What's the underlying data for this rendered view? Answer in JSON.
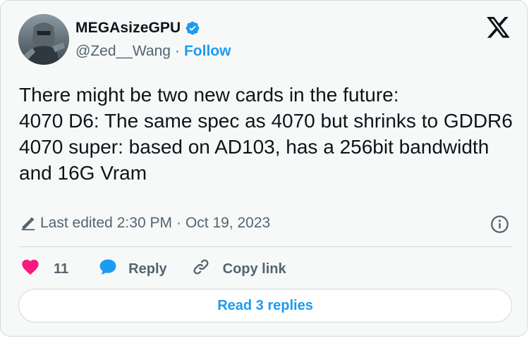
{
  "author": {
    "display_name": "MEGAsizeGPU",
    "handle": "@Zed__Wang",
    "separator": "·",
    "follow_label": "Follow"
  },
  "tweet": {
    "text": "There might be two new cards in the future:\n4070 D6: The same spec as 4070 but shrinks to GDDR6\n4070 super: based on AD103, has a 256bit bandwidth and 16G Vram",
    "edited_label": "Last edited",
    "time": "2:30 PM",
    "date_separator": "·",
    "date": "Oct 19, 2023"
  },
  "actions": {
    "like_count": "11",
    "reply_label": "Reply",
    "copy_label": "Copy link"
  },
  "read_replies_label": "Read 3 replies",
  "icons": {
    "verified": "verified-badge-icon",
    "logo": "x-logo-icon",
    "edit": "pencil-icon",
    "info": "info-icon",
    "like": "heart-icon",
    "reply": "speech-bubble-icon",
    "copy": "link-icon"
  },
  "colors": {
    "accent": "#1d9bf0",
    "like": "#f91880",
    "muted_text": "#536471",
    "text": "#0f1419",
    "card_bg": "#f7f9f9",
    "border": "#cfd9de"
  }
}
